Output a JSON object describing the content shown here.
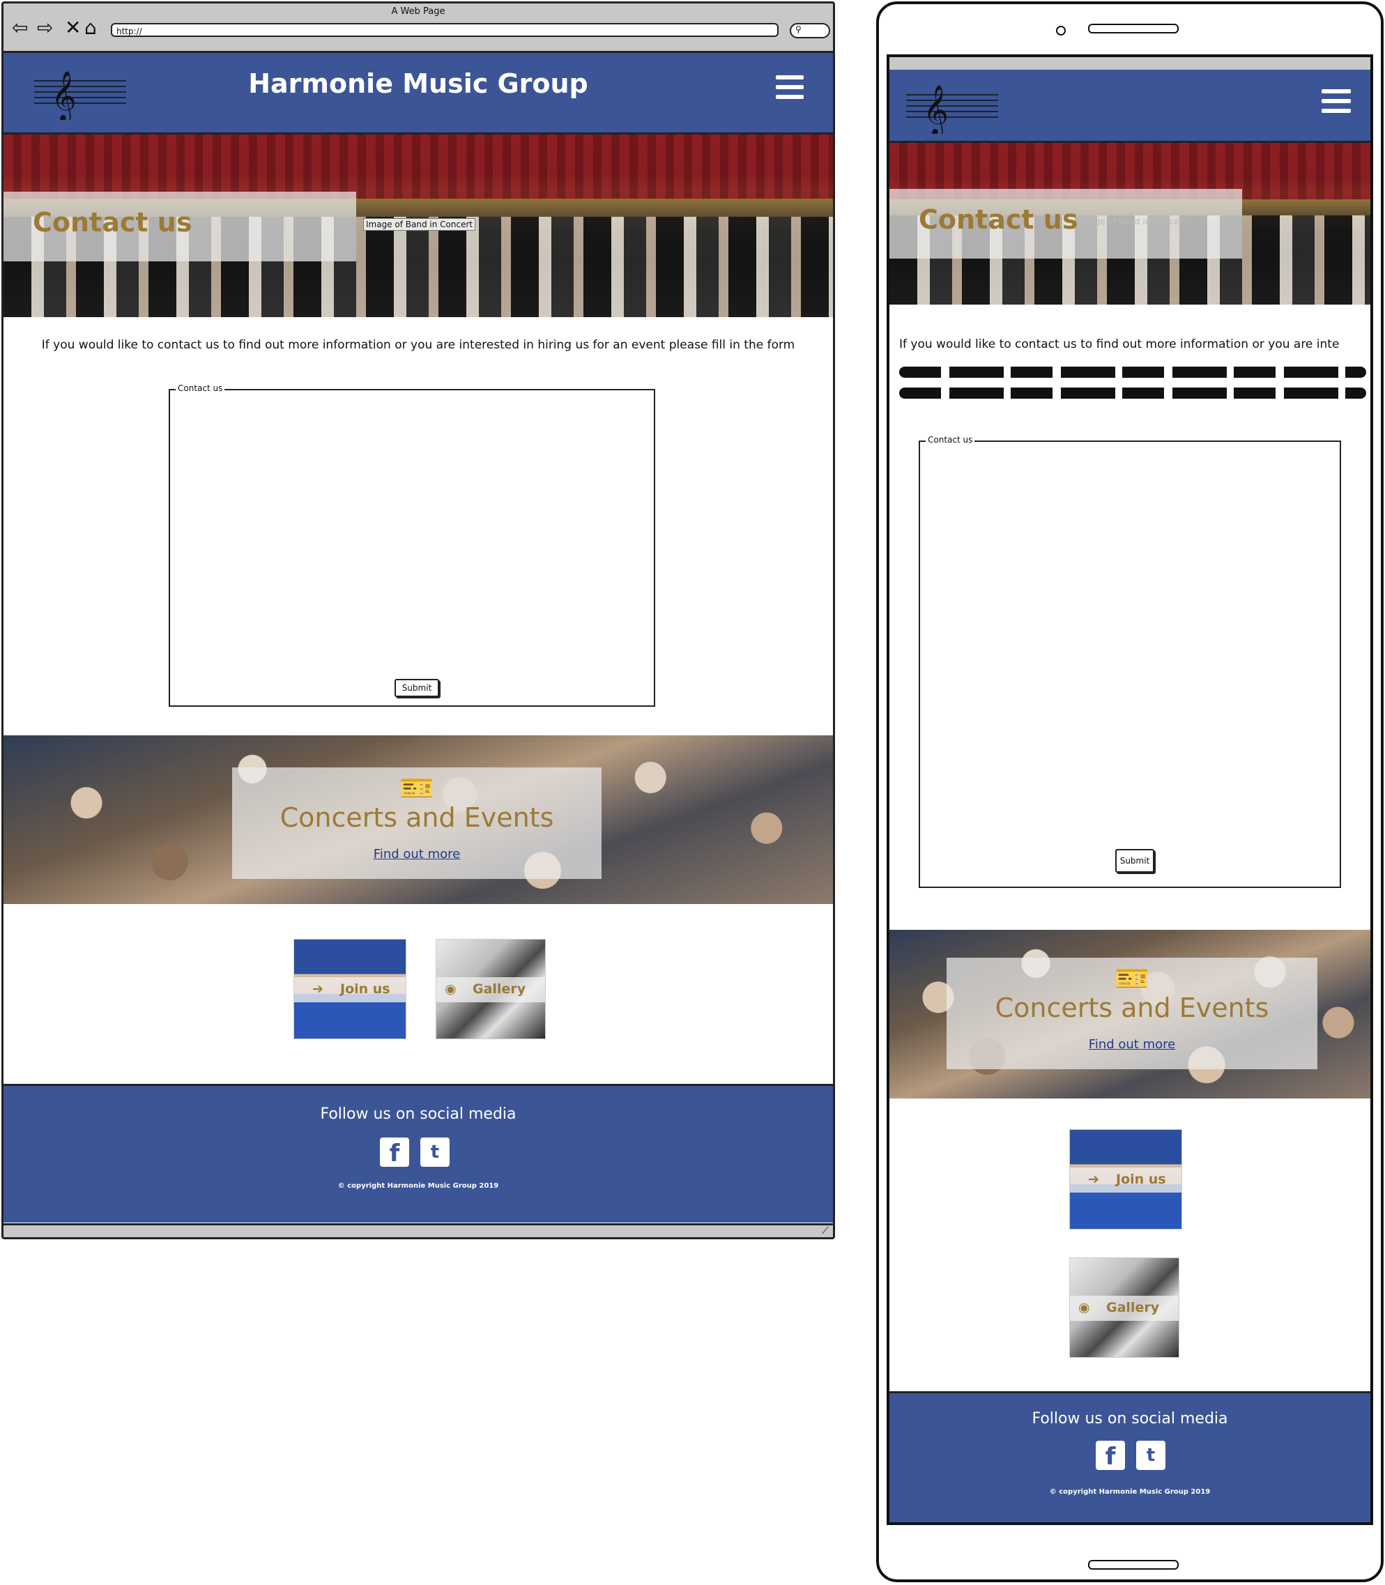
{
  "desktop": {
    "window_title": "A Web Page",
    "url": "http://",
    "site_title": "Harmonie Music Group",
    "logo_text": "Harmonie Music Group",
    "hero_heading": "Contact us",
    "hero_alt_label": "Image of Band in Concert",
    "intro_text": "If you would like to contact us to find out more information or you are interested in hiring us for an event please fill in the form",
    "form_legend": "Contact us",
    "submit_label": "Submit",
    "concerts_heading": "Concerts and Events",
    "concerts_link": "Find out more",
    "join_label": "Join us",
    "gallery_label": "Gallery",
    "footer_heading": "Follow us on social media",
    "copyright": "© copyright Harmonie Music Group 2019"
  },
  "mobile": {
    "hero_heading": "Contact us",
    "hero_alt_label": "Image of Band in Concert",
    "intro_text": "If you would like to contact us to find out more information or you are inte",
    "form_legend": "Contact us",
    "submit_label": "Submit",
    "concerts_heading": "Concerts and Events",
    "concerts_link": "Find out more",
    "join_label": "Join us",
    "gallery_label": "Gallery",
    "footer_heading": "Follow us on social media",
    "copyright": "© copyright Harmonie Music Group 2019"
  },
  "icons": {
    "back": "back-arrow-icon",
    "forward": "forward-arrow-icon",
    "stop": "close-icon",
    "home": "home-icon",
    "search": "search-icon",
    "menu": "hamburger-icon",
    "ticket": "ticket-icon",
    "join": "sign-in-icon",
    "gallery": "camera-icon",
    "facebook": "facebook-icon",
    "twitter": "twitter-icon"
  },
  "colors": {
    "header_blue": "#3b5596",
    "accent_gold": "#9c7a35",
    "link_blue": "#1d3c8a"
  }
}
